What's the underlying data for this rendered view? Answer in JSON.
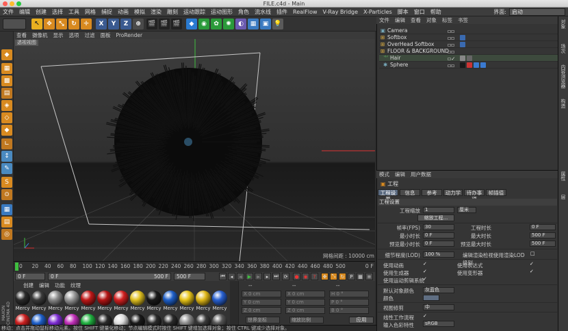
{
  "window": {
    "title": "FILE.c4d - Main"
  },
  "menubar": {
    "items": [
      "文件",
      "编辑",
      "创建",
      "选择",
      "工具",
      "网格",
      "捕捉",
      "动画",
      "模拟",
      "渲染",
      "雕刻",
      "运动跟踪",
      "运动图形",
      "角色",
      "流水线",
      "插件",
      "RealFlow",
      "V-Ray Bridge",
      "X-Particles",
      "脚本",
      "窗口",
      "帮助"
    ],
    "layout_label": "界面:",
    "layout_value": "启动"
  },
  "viewport": {
    "menu": [
      "查看",
      "摄像机",
      "显示",
      "选项",
      "过滤",
      "面板",
      "ProRender"
    ],
    "label": "透视视图",
    "grid_spacing": "网格间距 : 10000 cm"
  },
  "timeline": {
    "ticks": [
      "0",
      "20",
      "40",
      "60",
      "80",
      "100",
      "120",
      "140",
      "160",
      "180",
      "200",
      "220",
      "240",
      "260",
      "280",
      "300",
      "320",
      "340",
      "360",
      "380",
      "400",
      "420",
      "440",
      "460",
      "480",
      "500"
    ],
    "end": "0 F"
  },
  "transport": {
    "start": "0 F",
    "range_start": "0 F",
    "range_end": "500 F",
    "end": "500 F"
  },
  "materials": {
    "menu": [
      "创建",
      "编辑",
      "功能",
      "纹理"
    ],
    "row1": [
      {
        "name": "Mercy",
        "color": "#2a2a2a"
      },
      {
        "name": "Mercy",
        "color": "#3a3a3a"
      },
      {
        "name": "Mercy",
        "color": "#8a8a8a"
      },
      {
        "name": "Mercy",
        "color": "#9a9a9a"
      },
      {
        "name": "Mercy",
        "color": "#c01818"
      },
      {
        "name": "Mercy",
        "color": "#b31515"
      },
      {
        "name": "Mercy",
        "color": "#d22020"
      },
      {
        "name": "Mercy",
        "color": "#e0c020"
      },
      {
        "name": "Mercy",
        "color": "#1a1a1a"
      },
      {
        "name": "Mercy",
        "color": "#1e5fc8"
      },
      {
        "name": "Mercy",
        "color": "#e8c418"
      },
      {
        "name": "Mercy",
        "color": "#e0b818"
      },
      {
        "name": "Mercy",
        "color": "#2860d0"
      }
    ],
    "row2": [
      "#cc2020",
      "#1e5fc8",
      "#7a2ad0",
      "#c02fb8",
      "#20b040",
      "#2a2a2a",
      "#dddddd",
      "#1a1a1a",
      "#2a2a2a",
      "#2a2a2a",
      "#8a8a8a",
      "#3a3a3a",
      "#555555"
    ]
  },
  "coords": {
    "headers": [
      "--",
      "--",
      "--"
    ],
    "x": "X  0 cm",
    "y": "Y  0 cm",
    "z": "Z  0 cm",
    "x2": "X  0 cm",
    "y2": "Y  0 cm",
    "z2": "Z  0 cm",
    "h": "H  0 °",
    "p": "P  0 °",
    "b": "B  0 °",
    "sys": "世界坐标",
    "scale": "缩放比例",
    "apply": "应用"
  },
  "statusbar": "移动：点击并拖动鼠标移动元素。按住 SHIFT 键量化移动；节点编辑模式时按住 SHIFT 键增加选择对象；按住 CTRL 键减少选择对象。",
  "maxon": "MAXON CINEMA 4D",
  "object_manager": {
    "menu": [
      "文件",
      "编辑",
      "查看",
      "对象",
      "标签",
      "书签"
    ],
    "objects": [
      {
        "name": "Camera",
        "indent": 0
      },
      {
        "name": "Softbox",
        "indent": 0
      },
      {
        "name": "OverHead Softbox",
        "indent": 0
      },
      {
        "name": "FLOOR & BACKGROUND",
        "indent": 0
      },
      {
        "name": "Hair",
        "indent": 1
      },
      {
        "name": "Sphere",
        "indent": 1
      }
    ]
  },
  "right_tabs": [
    "对象",
    "场次",
    "内容浏览器",
    "构造",
    "属性",
    "层"
  ],
  "attributes": {
    "menu": [
      "模式",
      "编辑",
      "用户数据"
    ],
    "title": "工程",
    "tabs": [
      "工程设置",
      "信息",
      "参考",
      "动力学",
      "待办事项",
      "帧插值"
    ],
    "section": "工程设置",
    "project_scale_label": "工程缩放",
    "project_scale": "1",
    "project_scale_unit": "厘米",
    "scale_btn": "缩放工程...",
    "fps_label": "帧率(FPS)",
    "fps": "30",
    "project_time_label": "工程时长",
    "project_time": "0 F",
    "min_time_label": "最小时长",
    "min_time": "0 F",
    "max_time_label": "最大时长",
    "max_time": "500 F",
    "preview_min_label": "预览最小时长",
    "preview_min": "0 F",
    "preview_max_label": "预览最大时长",
    "preview_max": "500 F",
    "lod_label": "细节程度(LOD)",
    "lod": "100 %",
    "lod_render_label": "编辑渲染检视使用渲染LOD级别",
    "use_anim_label": "使用动画",
    "use_expr_label": "使用表达式",
    "use_gen_label": "使用生成器",
    "use_deform_label": "使用变形器",
    "use_motion_label": "使用运动剪辑系统",
    "default_color_label": "默认对象颜色",
    "default_color": "灰蓝色",
    "color_label": "颜色",
    "view_clip_label": "视图修剪",
    "view_clip": "中",
    "linear_label": "线性工作流程",
    "input_color_label": "输入色彩特性",
    "input_color": "sRGB"
  }
}
